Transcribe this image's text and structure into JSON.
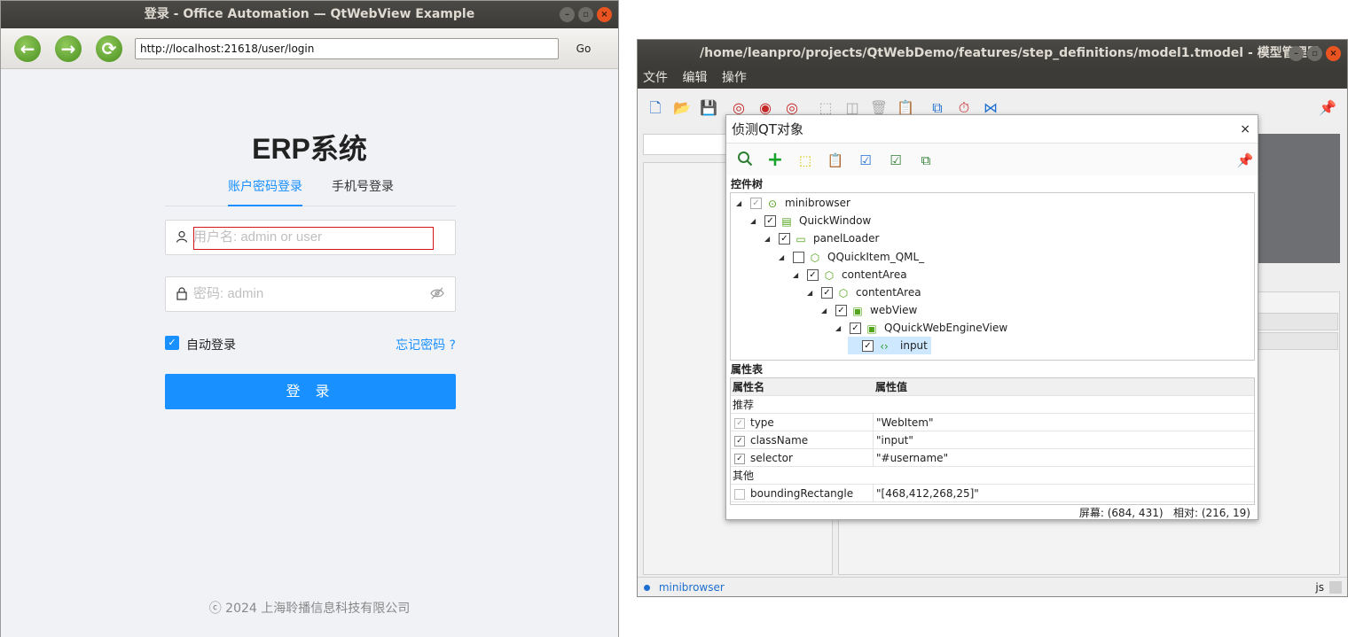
{
  "browser": {
    "title": "登录 - Office Automation — QtWebView Example",
    "url": "http://localhost:21618/user/login",
    "go_label": "Go",
    "nav_icons": [
      "back-arrow-icon",
      "forward-arrow-icon",
      "reload-icon"
    ]
  },
  "login": {
    "app_title": "ERP系统",
    "tab_account": "账户密码登录",
    "tab_phone": "手机号登录",
    "username_placeholder": "用户名: admin or user",
    "password_placeholder": "密码: admin",
    "remember_label": "自动登录",
    "remember_checked": true,
    "forgot_label": "忘记密码 ?",
    "login_button": "登 录",
    "footer": "ⓒ 2024 上海聆播信息科技有限公司",
    "accent_color": "#1890ff"
  },
  "model_manager": {
    "title": "/home/leanpro/projects/QtWebDemo/features/step_definitions/model1.tmodel - 模型管理器",
    "menu": [
      "文件",
      "编辑",
      "操作"
    ],
    "status_item": "minibrowser",
    "status_right": "js"
  },
  "dialog": {
    "title": "侦测QT对象",
    "close": "×",
    "tree_label": "控件树",
    "tree": [
      {
        "label": "minibrowser",
        "checked": true,
        "icon": "app-icon"
      },
      {
        "label": "QuickWindow",
        "checked": true,
        "icon": "window-icon"
      },
      {
        "label": "panelLoader",
        "checked": true,
        "icon": "folder-icon"
      },
      {
        "label": "QQuickItem_QML_",
        "checked": false,
        "icon": "cube-icon"
      },
      {
        "label": "contentArea",
        "checked": true,
        "icon": "cube-icon"
      },
      {
        "label": "contentArea",
        "checked": true,
        "icon": "cube-icon"
      },
      {
        "label": "webView",
        "checked": true,
        "icon": "webview-icon"
      },
      {
        "label": "QQuickWebEngineView",
        "checked": true,
        "icon": "webview-icon"
      },
      {
        "label": "input",
        "checked": true,
        "icon": "code-icon",
        "selected": true
      }
    ],
    "props_label": "属性表",
    "props_header": {
      "name": "属性名",
      "value": "属性值"
    },
    "group_recommended": "推荐",
    "group_other": "其他",
    "props": [
      {
        "name": "type",
        "value": "\"WebItem\"",
        "checked": true
      },
      {
        "name": "className",
        "value": "\"input\"",
        "checked": true
      },
      {
        "name": "selector",
        "value": "\"#username\"",
        "checked": true
      }
    ],
    "other_props": [
      {
        "name": "boundingRectangle",
        "value": "\"[468,412,268,25]\"",
        "checked": false
      }
    ],
    "status": "屏幕: (684, 431)   相对: (216, 19)"
  }
}
